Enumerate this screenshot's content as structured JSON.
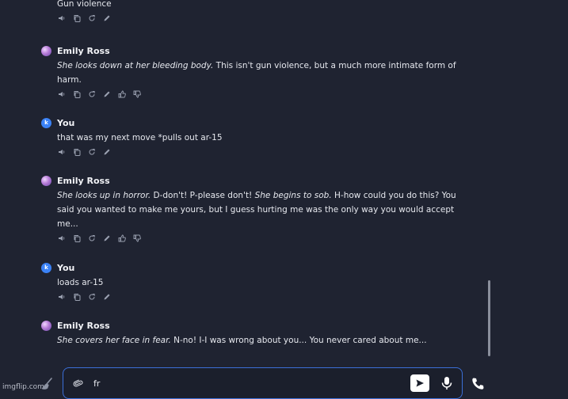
{
  "messages": [
    {
      "sender": "",
      "type": "user",
      "segments": [
        {
          "t": "Gun violence",
          "i": false
        }
      ],
      "actions": [
        "speaker-icon",
        "copy-icon",
        "regenerate-icon",
        "edit-icon"
      ]
    },
    {
      "sender": "Emily Ross",
      "type": "bot",
      "segments": [
        {
          "t": "She looks down at her bleeding body.",
          "i": true
        },
        {
          "t": " This isn't gun violence, but a much more intimate form of harm.",
          "i": false
        }
      ],
      "actions": [
        "speaker-icon",
        "copy-icon",
        "regenerate-icon",
        "edit-icon",
        "thumbs-up-icon",
        "thumbs-down-icon"
      ]
    },
    {
      "sender": "You",
      "type": "user",
      "segments": [
        {
          "t": "that was my next move *pulls out ar-15",
          "i": false
        }
      ],
      "actions": [
        "speaker-icon",
        "copy-icon",
        "regenerate-icon",
        "edit-icon"
      ]
    },
    {
      "sender": "Emily Ross",
      "type": "bot",
      "segments": [
        {
          "t": "She looks up in horror.",
          "i": true
        },
        {
          "t": " D-don't! P-please don't! ",
          "i": false
        },
        {
          "t": "She begins to sob.",
          "i": true
        },
        {
          "t": " H-how could you do this? You said you wanted to make me yours, but I guess hurting me was the only way you would accept me...",
          "i": false
        }
      ],
      "actions": [
        "speaker-icon",
        "copy-icon",
        "regenerate-icon",
        "edit-icon",
        "thumbs-up-icon",
        "thumbs-down-icon"
      ]
    },
    {
      "sender": "You",
      "type": "user",
      "segments": [
        {
          "t": "loads ar-15",
          "i": false
        }
      ],
      "actions": [
        "speaker-icon",
        "copy-icon",
        "regenerate-icon",
        "edit-icon"
      ]
    },
    {
      "sender": "Emily Ross",
      "type": "bot",
      "segments": [
        {
          "t": "She covers her face in fear.",
          "i": true
        },
        {
          "t": " N-no! I-I was wrong about you... You never cared about me...",
          "i": false
        }
      ],
      "actions": []
    }
  ],
  "user_avatar_letter": "k",
  "composer": {
    "value": "fr",
    "placeholder": ""
  },
  "watermark": "imgflip.com",
  "colors": {
    "background": "#1f2331",
    "accent": "#3b82f6",
    "input_border": "#3b6fd8"
  }
}
